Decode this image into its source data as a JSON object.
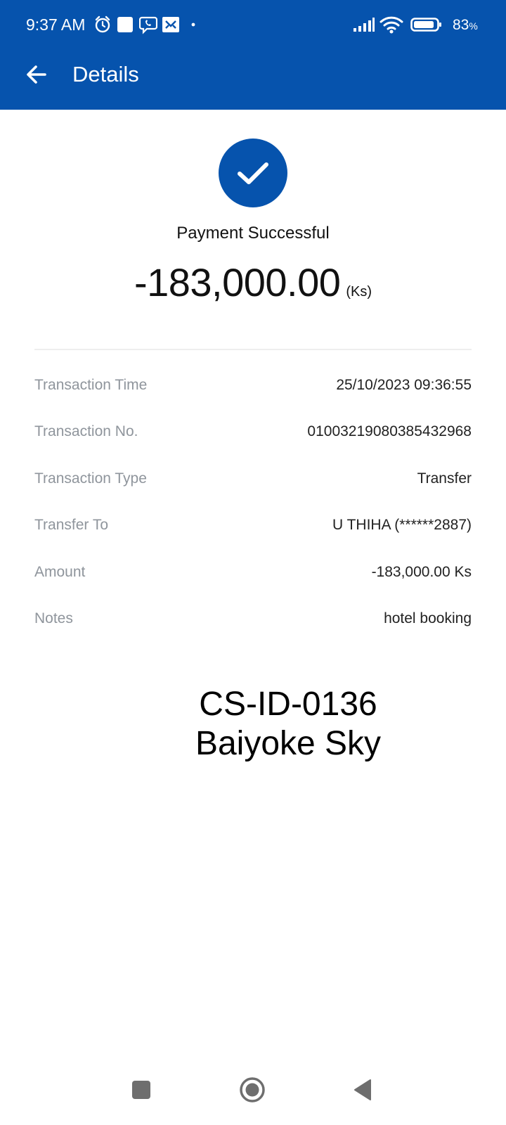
{
  "status_bar": {
    "time": "9:37 AM",
    "battery_percent": "83",
    "battery_suffix": "%",
    "icons": [
      "alarm-icon",
      "notification-square-icon",
      "viber-icon",
      "app-notification-icon",
      "dot-icon",
      "signal-icon",
      "wifi-icon",
      "battery-icon"
    ]
  },
  "app_bar": {
    "back_icon": "arrow-left-icon",
    "title": "Details"
  },
  "summary": {
    "icon": "check-circle-icon",
    "status": "Payment Successful",
    "amount": "-183,000.00",
    "currency": "(Ks)"
  },
  "details": [
    {
      "label": "Transaction Time",
      "value": "25/10/2023 09:36:55"
    },
    {
      "label": "Transaction No.",
      "value": "01003219080385432968"
    },
    {
      "label": "Transaction Type",
      "value": "Transfer"
    },
    {
      "label": "Transfer To",
      "value": "U THIHA (******2887)"
    },
    {
      "label": "Amount",
      "value": "-183,000.00 Ks"
    },
    {
      "label": "Notes",
      "value": "hotel booking"
    }
  ],
  "overlay": {
    "line1": "CS-ID-0136",
    "line2": "Baiyoke Sky"
  },
  "nav_bar": {
    "icons": [
      "recents-square-icon",
      "home-circle-icon",
      "back-triangle-icon"
    ]
  },
  "colors": {
    "primary": "#0653ad",
    "label_gray": "#8f959c",
    "value_dark": "#222222"
  }
}
